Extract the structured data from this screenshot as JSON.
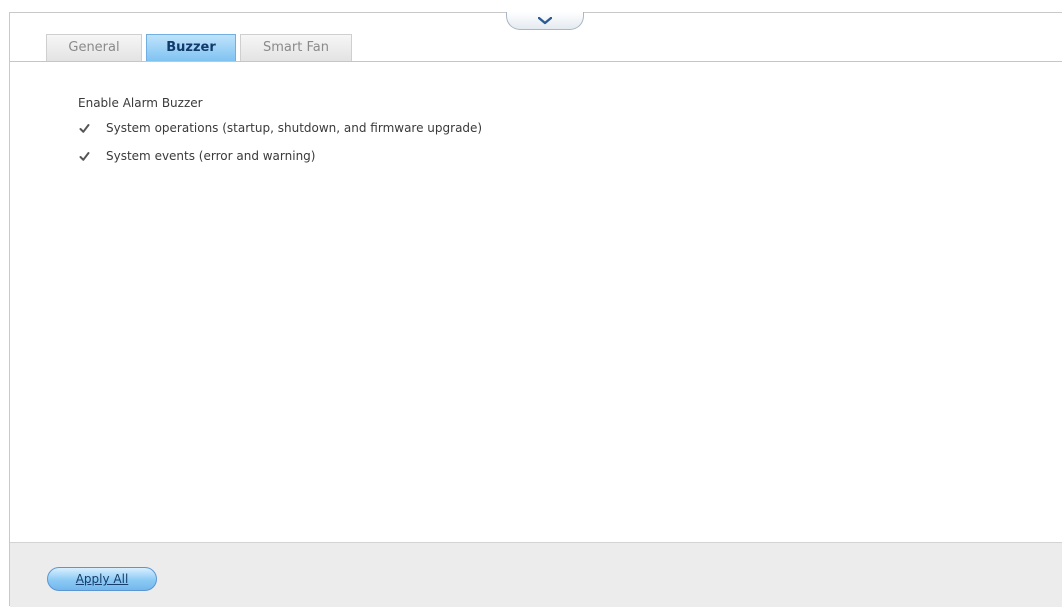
{
  "tabs": [
    {
      "label": "General"
    },
    {
      "label": "Buzzer",
      "active": true
    },
    {
      "label": "Smart Fan"
    }
  ],
  "buzzer": {
    "section_title": "Enable Alarm Buzzer",
    "options": [
      {
        "label": "System operations (startup, shutdown, and firmware upgrade)",
        "checked": true
      },
      {
        "label": "System events (error and warning)",
        "checked": true
      }
    ]
  },
  "footer": {
    "apply_all_label": "Apply All"
  },
  "icons": {
    "collapse": "chevron-down-icon",
    "checkbox": "checkmark-icon"
  },
  "colors": {
    "active_tab": "#8fcaf3",
    "button_accent": "#7fc0f0",
    "footer_bg": "#ececec"
  }
}
